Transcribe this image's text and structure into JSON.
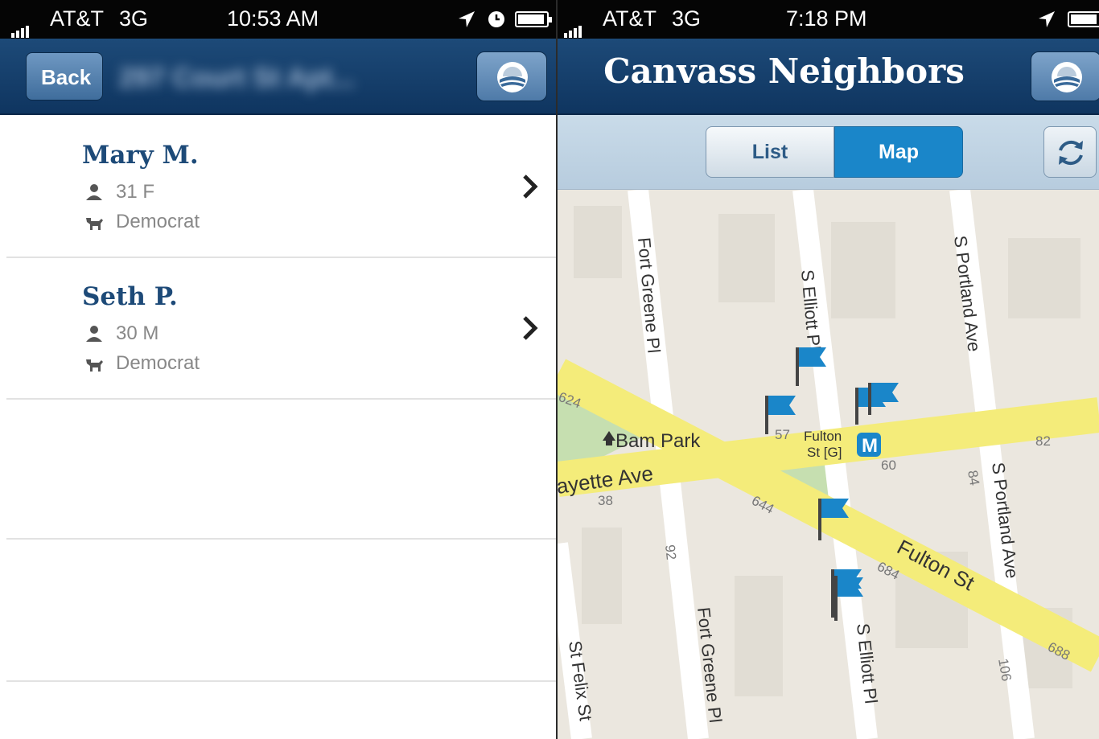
{
  "left": {
    "status": {
      "carrier": "AT&T",
      "network": "3G",
      "time": "10:53 AM"
    },
    "nav": {
      "back_label": "Back",
      "title_blurred": "297 Court St Apt..."
    },
    "voters": [
      {
        "name": "Mary M.",
        "age_gender": "31 F",
        "party": "Democrat"
      },
      {
        "name": "Seth P.",
        "age_gender": "30 M",
        "party": "Democrat"
      }
    ]
  },
  "right": {
    "status": {
      "carrier": "AT&T",
      "network": "3G",
      "time": "7:18 PM"
    },
    "nav": {
      "title": "Canvass Neighbors"
    },
    "segments": {
      "list": "List",
      "map": "Map",
      "selected": "Map"
    },
    "map": {
      "street_labels": {
        "fort_greene_top": "Fort Greene Pl",
        "s_elliott_top": "S Elliott Pl",
        "s_portland_top": "S Portland Ave",
        "park": "Bam Park",
        "lafayette": "ayette Ave",
        "fulton_station_1": "Fulton",
        "fulton_station_2": "St [G]",
        "subway": "M",
        "s_portland_bottom": "S Portland Ave",
        "fulton_st": "Fulton St",
        "fort_greene_bottom": "Fort Greene Pl",
        "s_elliott_bottom": "S Elliott Pl",
        "st_felix": "St Felix St"
      },
      "numbers": {
        "n624": "624",
        "n57": "57",
        "n60": "60",
        "n82": "82",
        "n84": "84",
        "n38": "38",
        "n644": "644",
        "n92": "92",
        "n684": "684",
        "n688": "688",
        "n106": "106"
      }
    }
  },
  "colors": {
    "nav": "#1d4a78",
    "accent": "#1a86c9",
    "flag": "#1a86c9",
    "road": "#f4ec7a",
    "park": "#c6dfb0"
  }
}
